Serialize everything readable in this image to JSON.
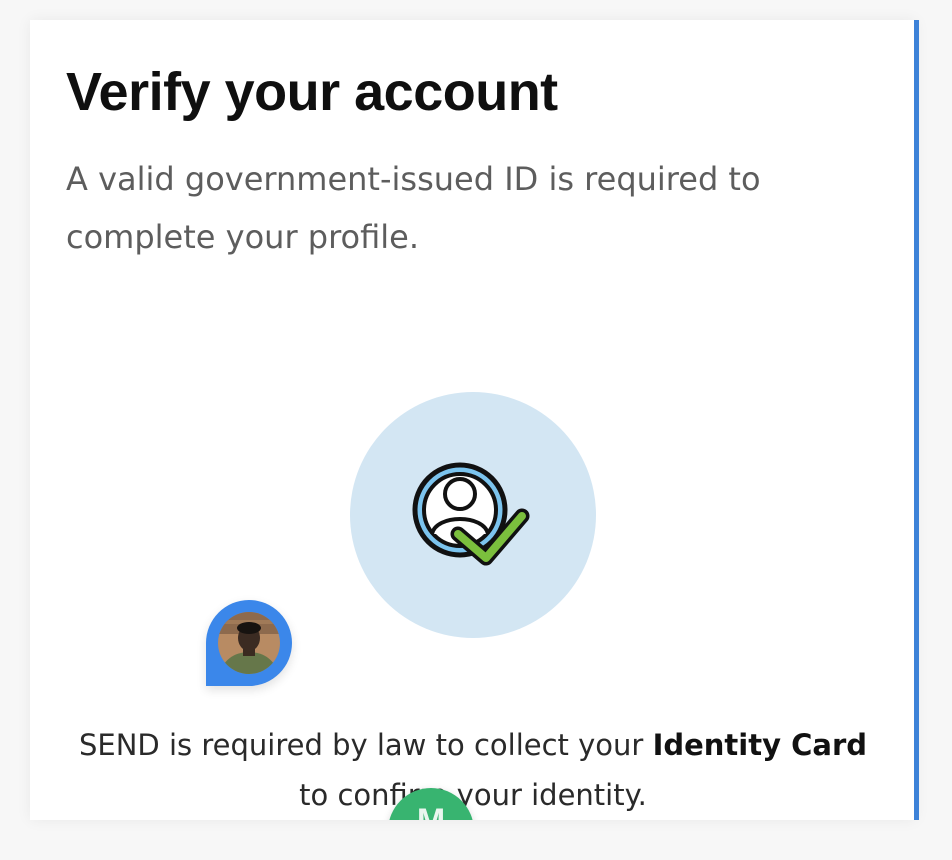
{
  "header": {
    "title": "Verify your account",
    "subtitle": "A valid government-issued ID is required to complete your profile."
  },
  "hero": {
    "icon": "verified-user-icon",
    "circle_color": "#d3e6f3",
    "check_color": "#7bbf3d"
  },
  "chat": {
    "avatar_icon": "user-avatar-photo",
    "bubble_color": "#3b87ea"
  },
  "notice": {
    "prefix": "SEND is required  by law to collect your ",
    "emphasis": "Identity Card",
    "suffix": " to confirm your identity."
  },
  "fab": {
    "letter": "M",
    "color": "#38b470"
  },
  "colors": {
    "accent": "#3d82d8",
    "title": "#0f0f0f",
    "body_text": "#5d5d5d"
  }
}
